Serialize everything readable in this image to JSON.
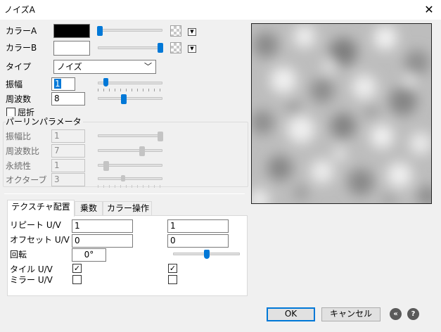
{
  "window": {
    "title": "ノイズA",
    "close_glyph": "✕"
  },
  "colors": {
    "accent": "#0078d7",
    "color_a": "#000000",
    "color_b": "#ffffff"
  },
  "color_a": {
    "label": "カラーA",
    "slider_fraction": 0.0
  },
  "color_b": {
    "label": "カラーB",
    "slider_fraction": 1.0
  },
  "type": {
    "label": "タイプ",
    "value": "ノイズ"
  },
  "amplitude": {
    "label": "振幅",
    "value": "1",
    "slider_fraction": 0.1
  },
  "frequency": {
    "label": "周波数",
    "value": "8",
    "slider_fraction": 0.4
  },
  "refraction": {
    "label": "屈折",
    "checked": false
  },
  "perlin": {
    "title": "パーリンパラメータ",
    "amplitude_ratio": {
      "label": "振幅比",
      "value": "1",
      "slider_fraction": 1.0
    },
    "frequency_ratio": {
      "label": "周波数比",
      "value": "7",
      "slider_fraction": 0.7
    },
    "persistence": {
      "label": "永続性",
      "value": "1",
      "slider_fraction": 0.1
    },
    "octave": {
      "label": "オクターブ",
      "value": "3",
      "slider_fraction": 0.4
    }
  },
  "tabs": [
    {
      "label": "テクスチャ配置"
    },
    {
      "label": "乗数"
    },
    {
      "label": "カラー操作"
    }
  ],
  "texture": {
    "repeat": {
      "label": "リピート U/V",
      "u": "1",
      "v": "1"
    },
    "offset": {
      "label": "オフセット U/V",
      "u": "0",
      "v": "0"
    },
    "rotation": {
      "label": "回転",
      "value": "0°",
      "slider_fraction": 0.5
    },
    "tile": {
      "label": "タイル U/V",
      "u_checked": true,
      "v_checked": true
    },
    "mirror": {
      "label": "ミラー U/V",
      "u_checked": false,
      "v_checked": false
    }
  },
  "buttons": {
    "ok": "OK",
    "cancel": "キャンセル"
  },
  "icons": {
    "back": "back-double-chevron-icon",
    "help": "help-icon"
  }
}
